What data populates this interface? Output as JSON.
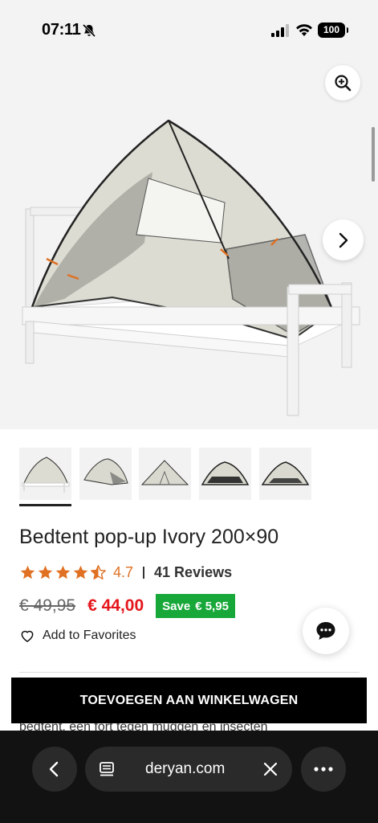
{
  "status_bar": {
    "time": "07:11",
    "battery": "100"
  },
  "product": {
    "title": "Bedtent pop-up Ivory 200×90",
    "rating": "4.7",
    "reviews": "41 Reviews",
    "stars_filled": 4.5,
    "old_price": "€ 49,95",
    "new_price": "€ 44,00",
    "save_label": "Save",
    "save_amount": "€ 5,95",
    "favorites_label": "Add to Favorites",
    "description_snippet": "bedtent, een fort tegen muggen en insecten"
  },
  "gallery": {
    "thumbnail_count": 5,
    "active_index": 0
  },
  "cart_button_label": "TOEVOEGEN AAN WINKELWAGEN",
  "browser": {
    "url": "deryan.com"
  },
  "colors": {
    "accent_orange": "#e07022",
    "price_red": "#e4161b",
    "save_green": "#17a839",
    "tent_ivory": "#d9d8cf",
    "bed_white": "#f7f7f7"
  },
  "icons": [
    "bell-slash-icon",
    "signal-icon",
    "wifi-icon",
    "zoom-in-icon",
    "chevron-right-icon",
    "star-icon",
    "heart-icon",
    "chat-icon",
    "chevron-left-icon",
    "page-icon",
    "close-icon",
    "more-icon"
  ]
}
